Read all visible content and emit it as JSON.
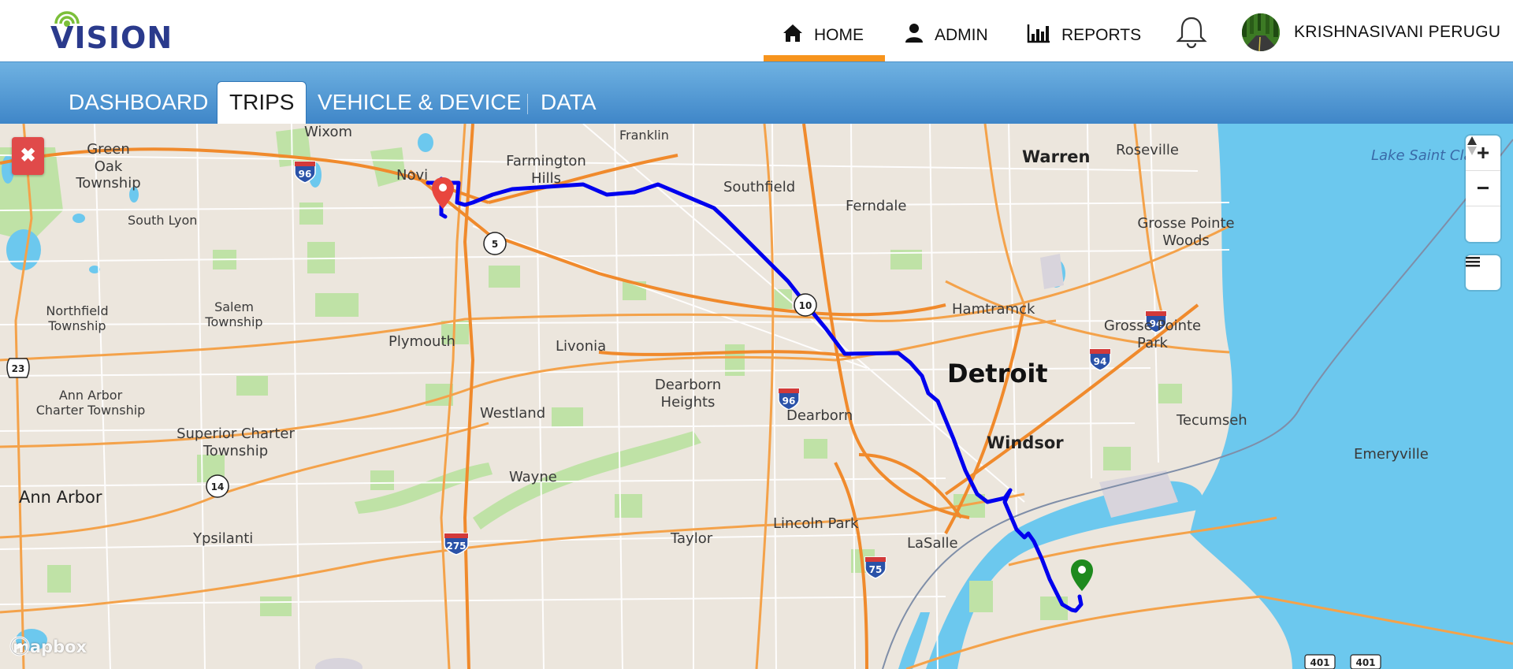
{
  "header": {
    "logo_text": "VISION",
    "nav": [
      {
        "label": "HOME",
        "icon": "home-icon",
        "active": true
      },
      {
        "label": "ADMIN",
        "icon": "user-icon",
        "active": false
      },
      {
        "label": "REPORTS",
        "icon": "bar-chart-icon",
        "active": false
      }
    ],
    "notifications_icon": "bell-icon",
    "user_name": "KRISHNASIVANI PERUGU",
    "accent_color": "#f7941d"
  },
  "subnav": {
    "tabs": [
      {
        "label": "DASHBOARD",
        "active": false
      },
      {
        "label": "TRIPS",
        "active": true
      },
      {
        "label": "VEHICLE & DEVICE",
        "active": false
      },
      {
        "label": "DATA",
        "active": false
      }
    ]
  },
  "map": {
    "close_label": "✖",
    "controls": {
      "zoom_in": "+",
      "zoom_out": "−",
      "compass": "compass-icon",
      "layers": "menu-icon"
    },
    "attribution": "mapbox",
    "route_color": "#0000ee",
    "start_marker_color": "#e8463e",
    "end_marker_color": "#1e8a1e",
    "water_labels": [
      "Lake Saint Clair"
    ],
    "places": [
      "Wixom",
      "Franklin",
      "Green Oak Township",
      "Novi",
      "Farmington Hills",
      "Southfield",
      "Warren",
      "Roseville",
      "Ferndale",
      "Grosse Pointe Woods",
      "South Lyon",
      "Hamtramck",
      "Northfield Township",
      "Salem Township",
      "Plymouth",
      "Livonia",
      "Grosse Pointe Park",
      "Detroit",
      "Ann Arbor Charter Township",
      "Dearborn Heights",
      "Westland",
      "Dearborn",
      "Windsor",
      "Tecumseh",
      "Superior Charter Township",
      "Emeryville",
      "Wayne",
      "Ann Arbor",
      "Lincoln Park",
      "Ypsilanti",
      "Taylor",
      "LaSalle"
    ],
    "road_shields": [
      "96",
      "5",
      "10",
      "96",
      "94",
      "94",
      "23",
      "14",
      "275",
      "75",
      "401",
      "401"
    ]
  }
}
